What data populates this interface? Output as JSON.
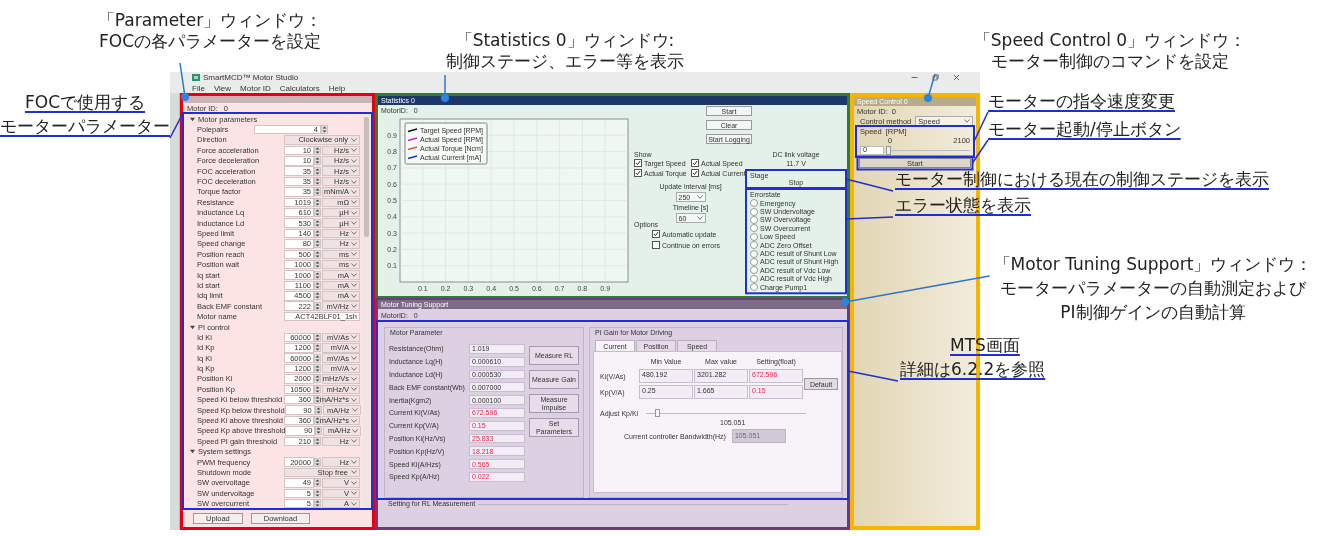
{
  "callouts": {
    "parameter_window": {
      "heading": "「Parameter」ウィンドウ：",
      "text": "FOCの各パラメーターを設定"
    },
    "statistics_window": {
      "heading": "「Statistics 0」ウィンドウ:",
      "text": "制御ステージ、エラー等を表示"
    },
    "speed_control_window": {
      "heading": "「Speed Control 0」ウィンドウ：",
      "text": "モーター制御のコマンドを設定"
    },
    "motor_parameters": {
      "lines": [
        "FOCで使用する",
        "モーターパラメーター"
      ]
    },
    "speed_change": "モーターの指令速度変更",
    "start_stop": "モーター起動/停止ボタン",
    "stage": "モーター制御における現在の制御ステージを表示",
    "error_state": "エラー状態を表示",
    "mts_window": {
      "heading": "「Motor Tuning Support」ウィンドウ：",
      "lines": [
        "モーターパラメーターの自動測定および",
        "PI制御ゲインの自動計算"
      ]
    },
    "mts_screen": {
      "heading": "MTS画面",
      "text": "詳細は6.2.2を参照"
    }
  },
  "app": {
    "title": "SmartMCD™ Motor Studio",
    "menu": [
      "File",
      "View",
      "Motor ID",
      "Calculators",
      "Help"
    ]
  },
  "parameter": {
    "motor_id_label": "Motor ID:",
    "motor_id": "0",
    "groups": [
      {
        "name": "Motor parameters",
        "expanded": true,
        "rows": [
          {
            "label": "Polepairs",
            "kind": "spin",
            "value": "4"
          },
          {
            "label": "Direction",
            "kind": "dropdown",
            "value": "Clockwise only"
          },
          {
            "label": "Force acceleration",
            "kind": "spin_unit",
            "value": "10",
            "unit": "Hz/s"
          },
          {
            "label": "Force deceleration",
            "kind": "spin_unit",
            "value": "10",
            "unit": "Hz/s"
          },
          {
            "label": "FOC acceleration",
            "kind": "spin_unit",
            "value": "35",
            "unit": "Hz/s"
          },
          {
            "label": "FOC deceleration",
            "kind": "spin_unit",
            "value": "35",
            "unit": "Hz/s"
          },
          {
            "label": "Torque factor",
            "kind": "spin_unit",
            "value": "35",
            "unit": "mNm/A"
          },
          {
            "label": "Resistance",
            "kind": "spin_unit",
            "value": "1019",
            "unit": "mΩ"
          },
          {
            "label": "Inductance Lq",
            "kind": "spin_unit",
            "value": "610",
            "unit": "µH"
          },
          {
            "label": "Inductance Ld",
            "kind": "spin_unit",
            "value": "530",
            "unit": "µH"
          },
          {
            "label": "Speed limit",
            "kind": "spin_unit",
            "value": "140",
            "unit": "Hz"
          },
          {
            "label": "Speed change",
            "kind": "spin_unit",
            "value": "80",
            "unit": "Hz"
          },
          {
            "label": "Position reach",
            "kind": "spin_unit",
            "value": "500",
            "unit": "ms"
          },
          {
            "label": "Position wait",
            "kind": "spin_unit",
            "value": "1000",
            "unit": "ms"
          },
          {
            "label": "Iq start",
            "kind": "spin_unit",
            "value": "1000",
            "unit": "mA"
          },
          {
            "label": "Id start",
            "kind": "spin_unit",
            "value": "1100",
            "unit": "mA"
          },
          {
            "label": "Idq limit",
            "kind": "spin_unit",
            "value": "4500",
            "unit": "mA"
          },
          {
            "label": "Back EMF constant",
            "kind": "spin_unit",
            "value": "222",
            "unit": "mV/Hz"
          },
          {
            "label": "Motor name",
            "kind": "text",
            "value": "ACT42BLF01_1sh"
          }
        ]
      },
      {
        "name": "PI control",
        "expanded": true,
        "rows": [
          {
            "label": "Id Ki",
            "kind": "spin_unit",
            "value": "60000",
            "unit": "mV/As"
          },
          {
            "label": "Id Kp",
            "kind": "spin_unit",
            "value": "1200",
            "unit": "mV/A"
          },
          {
            "label": "Iq Ki",
            "kind": "spin_unit",
            "value": "60000",
            "unit": "mV/As"
          },
          {
            "label": "Iq Kp",
            "kind": "spin_unit",
            "value": "1200",
            "unit": "mV/A"
          },
          {
            "label": "Position Ki",
            "kind": "spin_unit",
            "value": "2000",
            "unit": "mHz/Vs"
          },
          {
            "label": "Position Kp",
            "kind": "spin_unit",
            "value": "10500",
            "unit": "mHz/V"
          },
          {
            "label": "Speed Ki below threshold",
            "kind": "spin_unit",
            "value": "360",
            "unit": "mA/Hz*s"
          },
          {
            "label": "Speed Kp below threshold",
            "kind": "spin_unit",
            "value": "90",
            "unit": "mA/Hz"
          },
          {
            "label": "Speed Ki above threshold",
            "kind": "spin_unit",
            "value": "360",
            "unit": "mA/Hz*s"
          },
          {
            "label": "Speed Kp above threshold",
            "kind": "spin_unit",
            "value": "90",
            "unit": "mA/Hz"
          },
          {
            "label": "Speed PI gain threshold",
            "kind": "spin_unit",
            "value": "210",
            "unit": "Hz"
          }
        ]
      },
      {
        "name": "System settings",
        "expanded": true,
        "rows": [
          {
            "label": "PWM frequency",
            "kind": "spin_unit",
            "value": "20000",
            "unit": "Hz"
          },
          {
            "label": "Shutdown mode",
            "kind": "dropdown",
            "value": "Stop free"
          },
          {
            "label": "SW overvoltage",
            "kind": "spin_unit",
            "value": "49",
            "unit": "V"
          },
          {
            "label": "SW undervoltage",
            "kind": "spin_unit",
            "value": "5",
            "unit": "V"
          },
          {
            "label": "SW overcurrent",
            "kind": "spin_unit",
            "value": "5",
            "unit": "A"
          }
        ]
      }
    ],
    "buttons": [
      "Upload",
      "Download"
    ]
  },
  "statistics": {
    "title": "Statistics 0",
    "motor_id_label": "MotorID:",
    "motor_id": "0",
    "chart_data": {
      "type": "line",
      "series": [
        {
          "name": "Target Speed [RPM]",
          "color": "#111111",
          "values": [
            null,
            null,
            null,
            null,
            null,
            null,
            null,
            null,
            null
          ]
        },
        {
          "name": "Actual Speed [RPM]",
          "color": "#d21fc8",
          "values": [
            null,
            null,
            null,
            null,
            null,
            null,
            null,
            null,
            null
          ]
        },
        {
          "name": "Actual Torque [Ncm]",
          "color": "#e8502a",
          "values": [
            null,
            null,
            null,
            null,
            null,
            null,
            null,
            null,
            null
          ]
        },
        {
          "name": "Actual Current [mA]",
          "color": "#1c2fd0",
          "values": [
            null,
            null,
            null,
            null,
            null,
            null,
            null,
            null,
            null
          ]
        }
      ],
      "categories": [
        "0.1",
        "0.2",
        "0.3",
        "0.4",
        "0.5",
        "0.6",
        "0.7",
        "0.8",
        "0.9"
      ],
      "ylim": [
        0,
        1
      ],
      "yticks": [
        0.1,
        0.2,
        0.3,
        0.4,
        0.5,
        0.6,
        0.7,
        0.8,
        0.9
      ],
      "grid": true
    },
    "buttons": [
      "Start",
      "Clear",
      "Start Logging"
    ],
    "show_label": "Show",
    "show": [
      {
        "label": "Target Speed",
        "checked": true
      },
      {
        "label": "Actual Speed",
        "checked": true
      },
      {
        "label": "Actual Torque",
        "checked": true
      },
      {
        "label": "Actual Current",
        "checked": true
      }
    ],
    "dc_link_label": "DC link voltage",
    "dc_link_value": "11.7 V",
    "update_interval_label": "Update interval [ms]",
    "update_interval": "250",
    "timeline_label": "Timeline [s]",
    "timeline": "60",
    "options_label": "Options",
    "options": [
      {
        "label": "Automatic update",
        "checked": true
      },
      {
        "label": "Continue on errors",
        "checked": false
      }
    ],
    "stage_label": "Stage",
    "stage": "Stop",
    "errorstate_label": "Errorstate",
    "errors": [
      {
        "label": "Emergency",
        "selected": false
      },
      {
        "label": "SW Undervoltage",
        "selected": false
      },
      {
        "label": "SW Overvoltage",
        "selected": false
      },
      {
        "label": "SW Overcurrent",
        "selected": false
      },
      {
        "label": "Low Speed",
        "selected": false
      },
      {
        "label": "ADC Zero Offset",
        "selected": false
      },
      {
        "label": "ADC result of Shunt Low",
        "selected": false
      },
      {
        "label": "ADC result of Shunt High",
        "selected": false
      },
      {
        "label": "ADC result of Vdc Low",
        "selected": false
      },
      {
        "label": "ADC result of Vdc High",
        "selected": false
      },
      {
        "label": "Charge Pump1",
        "selected": false
      }
    ]
  },
  "speed_control": {
    "title": "Speed Control 0",
    "motor_id_label": "Motor ID:",
    "motor_id": "0",
    "control_method_label": "Control method",
    "control_method": "Speed",
    "speed_label": "Speed",
    "speed_unit": "[RPM]",
    "min": "0",
    "max": "2100",
    "input": "0",
    "slider": {
      "level": 0
    },
    "start": "Start"
  },
  "mts": {
    "title": "Motor Tuning Support",
    "motor_id_label": "MotorID:",
    "motor_id": "0",
    "motor_parameter": {
      "title": "Motor Parameter",
      "rows": [
        {
          "label": "Resistance(Ohm)",
          "value": "1.019",
          "kind": "input"
        },
        {
          "label": "Inductance Lq(H)",
          "value": "0.000610",
          "kind": "input"
        },
        {
          "label": "Inductance Ld(H)",
          "value": "0.000530",
          "kind": "input"
        },
        {
          "label": "Back EMF constant(Wb)",
          "value": "0.007000",
          "kind": "input"
        },
        {
          "label": "Inertia(Kgm2)",
          "value": "0.000100",
          "kind": "input"
        },
        {
          "label": "Current Ki(V/As)",
          "value": "672.596",
          "kind": "computed"
        },
        {
          "label": "Current Kp(V/A)",
          "value": "0.15",
          "kind": "computed"
        },
        {
          "label": "Position Ki(Hz/Vs)",
          "value": "25.833",
          "kind": "computed"
        },
        {
          "label": "Position Kp(Hz/V)",
          "value": "18.218",
          "kind": "computed"
        },
        {
          "label": "Speed Ki(A/Hzs)",
          "value": "0.565",
          "kind": "computed"
        },
        {
          "label": "Speed Kp(A/Hz)",
          "value": "0.022",
          "kind": "computed"
        }
      ],
      "buttons": [
        "Measure RL",
        "Measure Gain",
        "Measure Impulse",
        "Set Parameters"
      ]
    },
    "pi_gain": {
      "title": "PI Gain for Motor Driving",
      "tabs": [
        {
          "label": "Current",
          "selected": true
        },
        {
          "label": "Position",
          "selected": false
        },
        {
          "label": "Speed",
          "selected": false
        }
      ],
      "columns": [
        "Min Value",
        "Max value",
        "Setting(float)"
      ],
      "rows": [
        {
          "label": "Ki(V/As)",
          "values": [
            "480.192",
            "3201.282",
            "672.596"
          ]
        },
        {
          "label": "Kp(V/A)",
          "values": [
            "0.25",
            "1.665",
            "0.15"
          ]
        }
      ],
      "default_button": "Default",
      "adjust_label": "Adjust Kp/Ki",
      "adjust": {
        "level": 0.06
      },
      "adjust_reading": "105.051",
      "bandwidth_label": "Current controller Bandwidth(Hz)",
      "bandwidth_value": "105.051",
      "bandwidth_disabled": true
    },
    "rl_group": "Setting for RL Measurement"
  }
}
